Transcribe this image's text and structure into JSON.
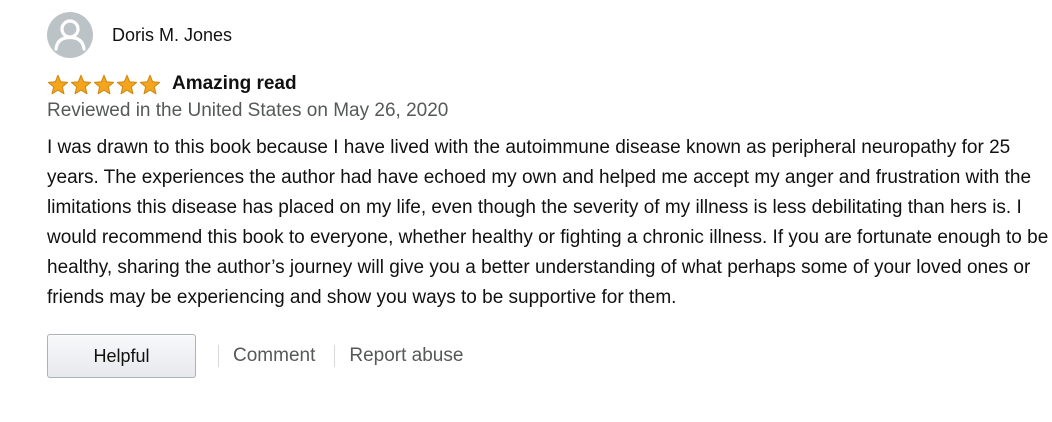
{
  "reviewer": {
    "name": "Doris M. Jones",
    "avatar_icon": "user-silhouette-icon"
  },
  "rating": {
    "stars": 5,
    "max": 5,
    "star_color": "#f4a41d",
    "star_stroke": "#d08b13"
  },
  "review": {
    "title": "Amazing read",
    "date_line": "Reviewed in the United States on May 26, 2020",
    "body": "I was drawn to this book because I have lived with the autoimmune disease known as peripheral neuropathy for 25 years. The experiences the author had have echoed my own and helped me accept my anger and frustration with the limitations this disease has placed on my life, even though the severity of my illness is less debilitating than hers is. I would recommend this book to everyone, whether healthy or fighting a chronic illness. If you are fortunate enough to be healthy, sharing the author’s journey will give you a better understanding of what perhaps some of your loved ones or friends may be experiencing and show you ways to be supportive for them."
  },
  "actions": {
    "helpful_label": "Helpful",
    "comment_label": "Comment",
    "report_label": "Report abuse"
  }
}
